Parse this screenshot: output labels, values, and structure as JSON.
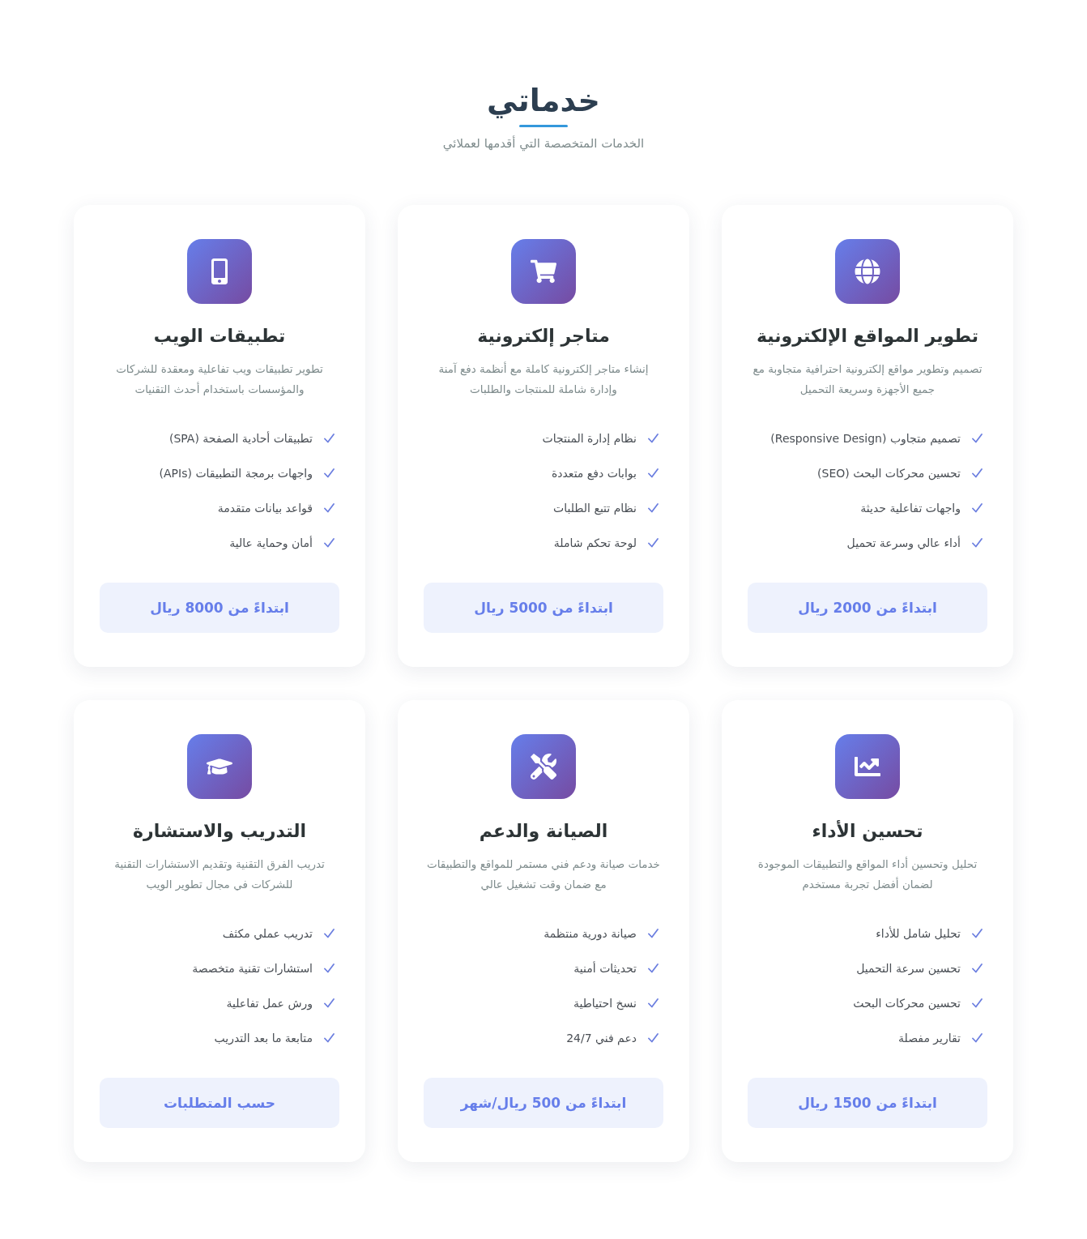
{
  "header": {
    "title": "خدماتي",
    "subtitle": "الخدمات المتخصصة التي أقدمها لعملائي"
  },
  "services": [
    {
      "title": "تطوير المواقع الإلكترونية",
      "description": "تصميم وتطوير مواقع إلكترونية احترافية متجاوبة مع جميع الأجهزة وسريعة التحميل",
      "features": [
        "تصميم متجاوب (Responsive Design)",
        "تحسين محركات البحث (SEO)",
        "واجهات تفاعلية حديثة",
        "أداء عالي وسرعة تحميل"
      ],
      "price": "ابتداءً من 2000 ريال"
    },
    {
      "title": "متاجر إلكترونية",
      "description": "إنشاء متاجر إلكترونية كاملة مع أنظمة دفع آمنة وإدارة شاملة للمنتجات والطلبات",
      "features": [
        "نظام إدارة المنتجات",
        "بوابات دفع متعددة",
        "نظام تتبع الطلبات",
        "لوحة تحكم شاملة"
      ],
      "price": "ابتداءً من 5000 ريال"
    },
    {
      "title": "تطبيقات الويب",
      "description": "تطوير تطبيقات ويب تفاعلية ومعقدة للشركات والمؤسسات باستخدام أحدث التقنيات",
      "features": [
        "تطبيقات أحادية الصفحة (SPA)",
        "واجهات برمجة التطبيقات (APIs)",
        "قواعد بيانات متقدمة",
        "أمان وحماية عالية"
      ],
      "price": "ابتداءً من 8000 ريال"
    },
    {
      "title": "تحسين الأداء",
      "description": "تحليل وتحسين أداء المواقع والتطبيقات الموجودة لضمان أفضل تجربة مستخدم",
      "features": [
        "تحليل شامل للأداء",
        "تحسين سرعة التحميل",
        "تحسين محركات البحث",
        "تقارير مفصلة"
      ],
      "price": "ابتداءً من 1500 ريال"
    },
    {
      "title": "الصيانة والدعم",
      "description": "خدمات صيانة ودعم فني مستمر للمواقع والتطبيقات مع ضمان وقت تشغيل عالي",
      "features": [
        "صيانة دورية منتظمة",
        "تحديثات أمنية",
        "نسخ احتياطية",
        "دعم فني 24/7"
      ],
      "price": "ابتداءً من 500 ريال/شهر"
    },
    {
      "title": "التدريب والاستشارة",
      "description": "تدريب الفرق التقنية وتقديم الاستشارات التقنية للشركات في مجال تطوير الويب",
      "features": [
        "تدريب عملي مكثف",
        "استشارات تقنية متخصصة",
        "ورش عمل تفاعلية",
        "متابعة ما بعد التدريب"
      ],
      "price": "حسب المتطلبات"
    }
  ]
}
